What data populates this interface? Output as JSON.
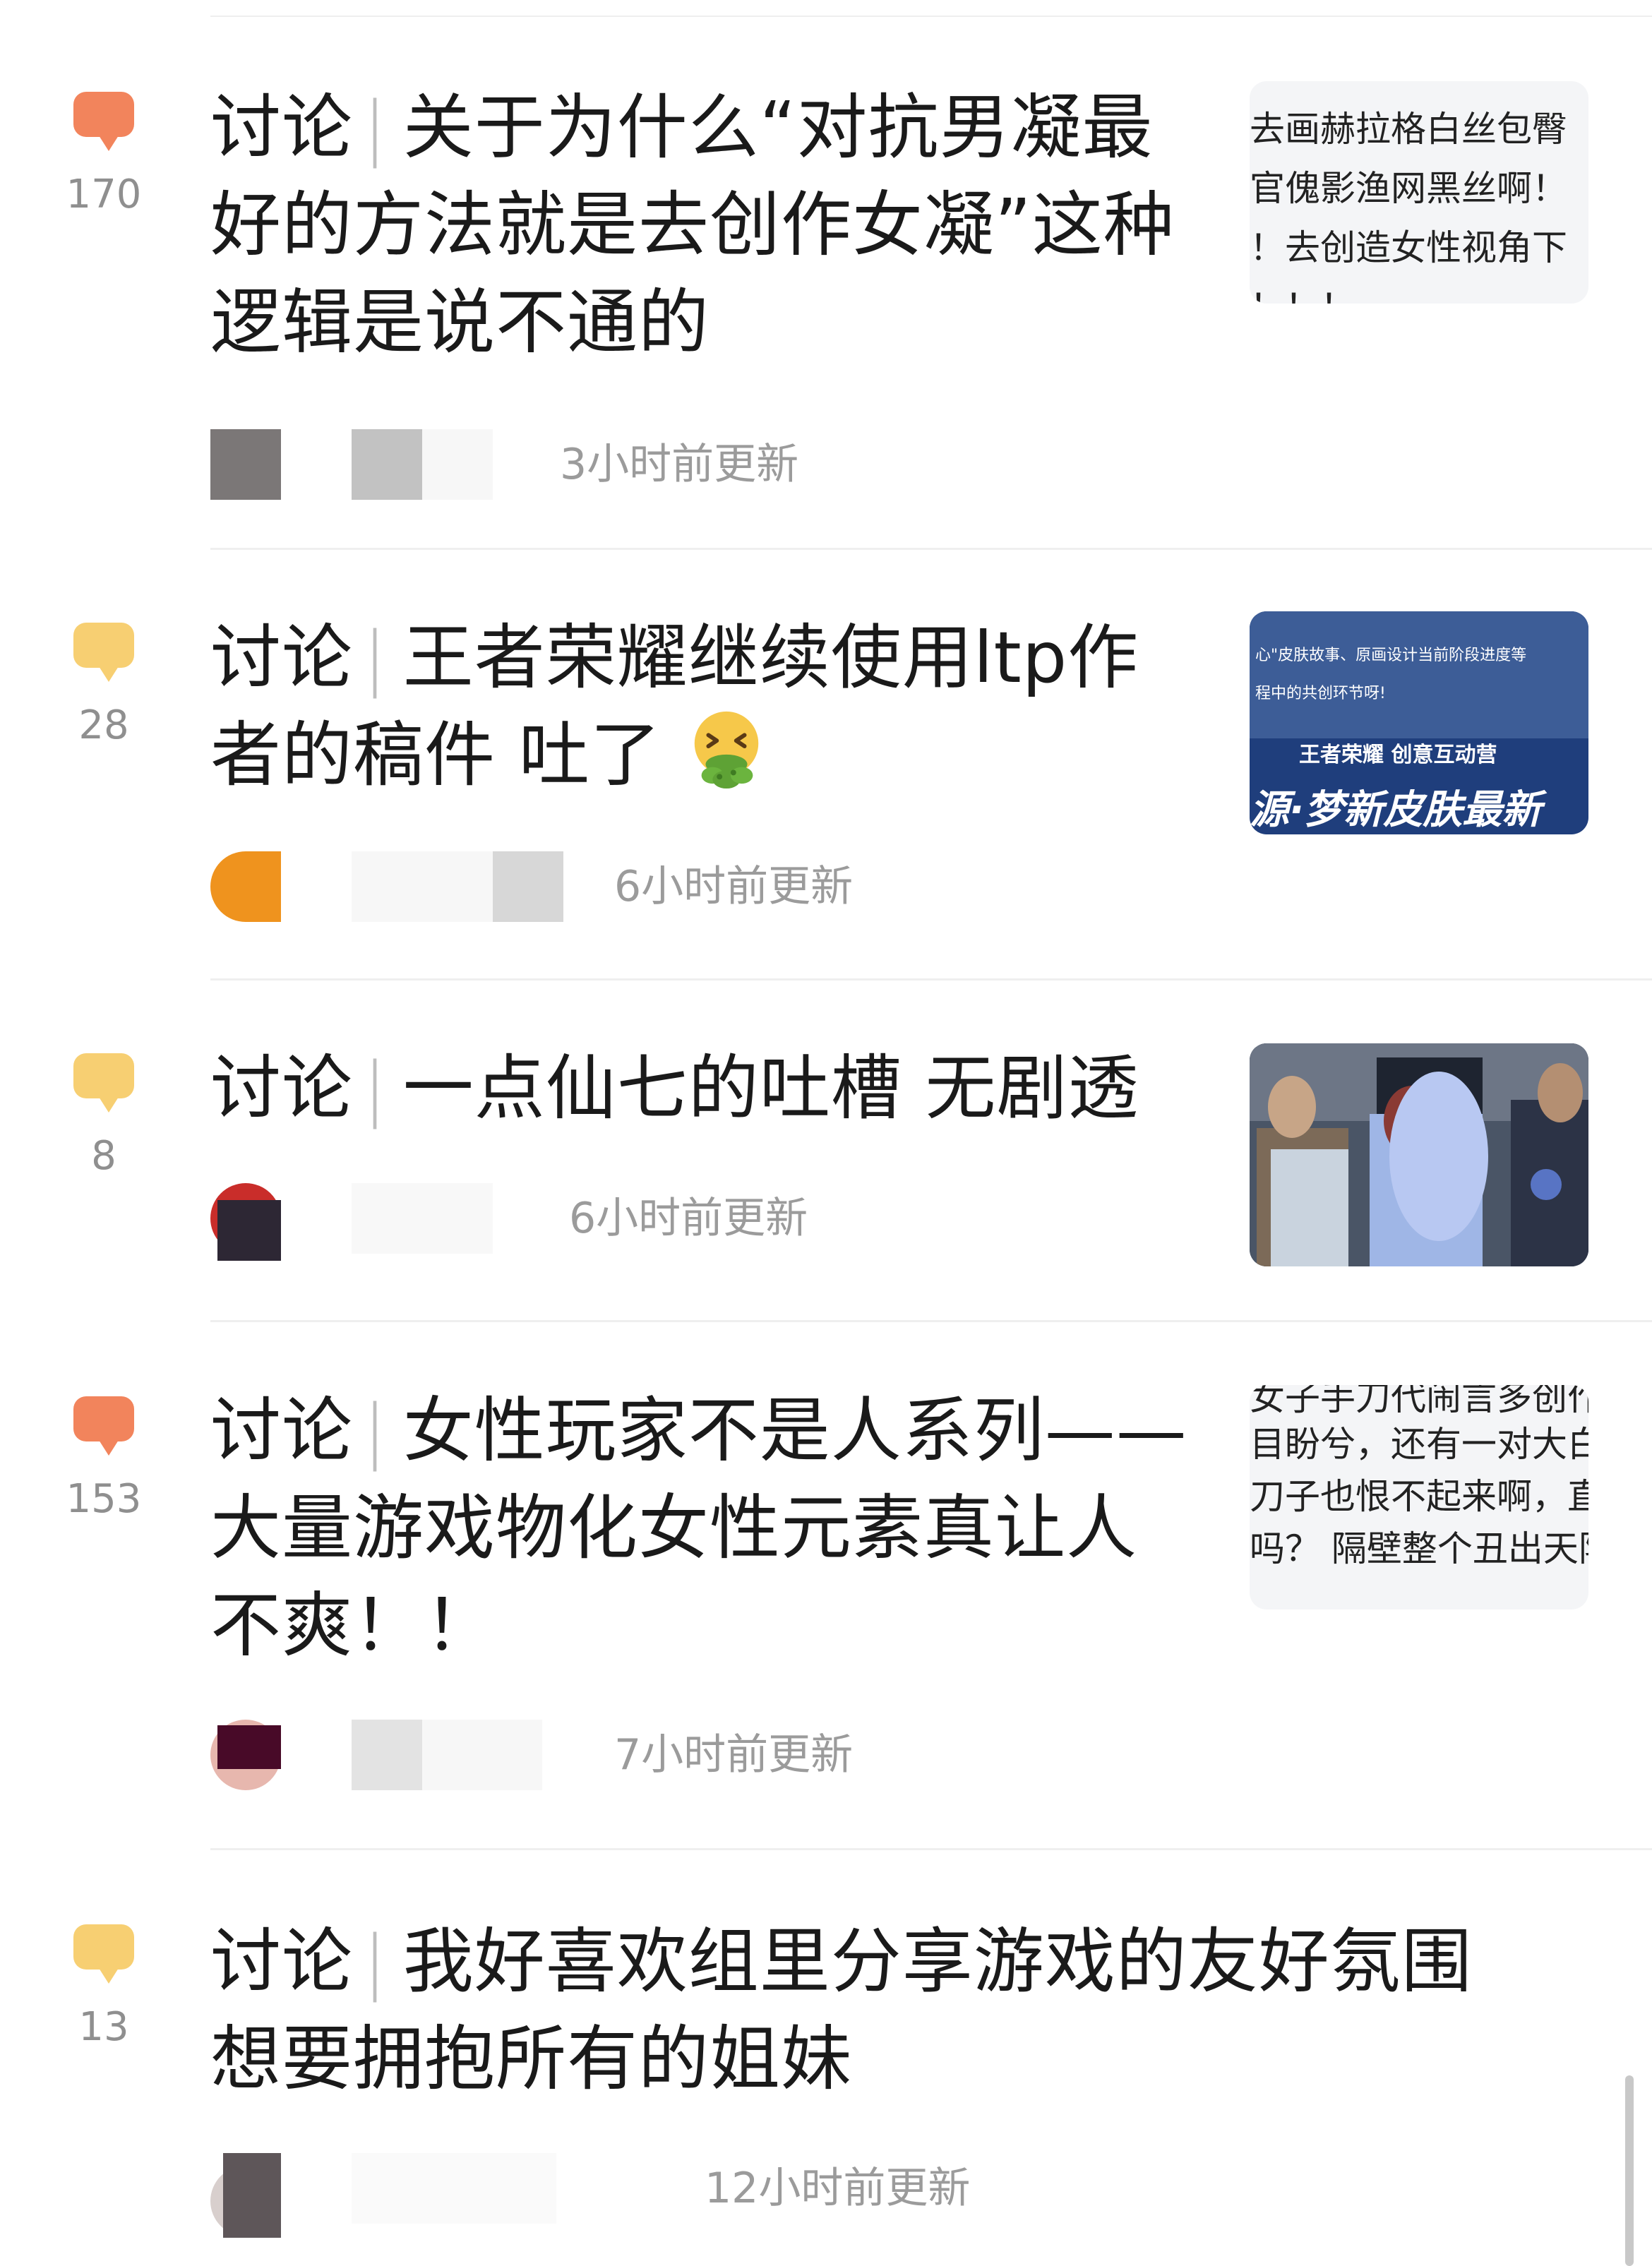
{
  "posts": [
    {
      "comment_count": "170",
      "bubble_color": "#f2845c",
      "category": "讨论",
      "title": "关于为什么“对抗男凝最好的方法就是去创作女凝”这种逻辑是说不通的",
      "time": "3小时前更新",
      "thumb_type": "text",
      "thumb_lines": [
        "去画赫拉格白丝包臀",
        "官傀影渔网黑丝啊！",
        "！去创造女性视角下",
        "！！！"
      ]
    },
    {
      "comment_count": "28",
      "bubble_color": "#f7cf72",
      "category": "讨论",
      "title": "王者荣耀继续使用ltp作者的稿件 吐了",
      "emoji": "vomiting-face-emoji",
      "time": "6小时前更新",
      "thumb_type": "image",
      "thumb_lines": [
        "心\"皮肤故事、原画设计当前阶段进度等",
        "程中的共创环节呀!",
        "王者荣耀 创意互动营",
        "源·梦新皮肤最新"
      ]
    },
    {
      "comment_count": "8",
      "bubble_color": "#f7cf72",
      "category": "讨论",
      "title": "一点仙七的吐槽 无剧透",
      "time": "6小时前更新",
      "thumb_type": "image",
      "thumb_lines": []
    },
    {
      "comment_count": "153",
      "bubble_color": "#f2845c",
      "category": "讨论",
      "title": "女性玩家不是人系列——大量游戏物化女性元素真让人不爽！！",
      "time": "7小时前更新",
      "thumb_type": "text",
      "thumb_lines": [
        "女子手刀代闹言多创作",
        "目盼兮，还有一对大白",
        "刀子也恨不起来啊，直",
        "吗？ 隔壁整个丑出天际"
      ]
    },
    {
      "comment_count": "13",
      "bubble_color": "#f7cf72",
      "category": "讨论",
      "title": "我好喜欢组里分享游戏的友好氛围想要拥抱所有的姐妹",
      "time": "12小时前更新",
      "thumb_type": "none",
      "thumb_lines": []
    }
  ]
}
